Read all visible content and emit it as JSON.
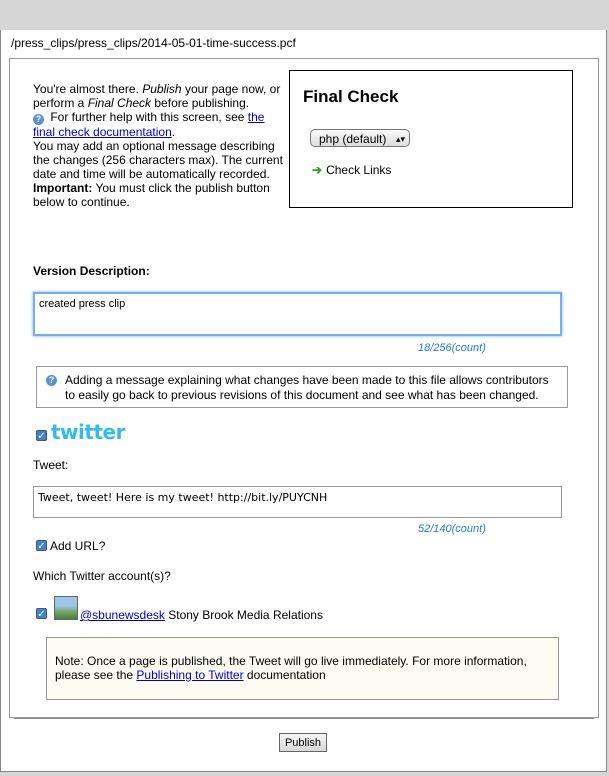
{
  "path": "/press_clips/press_clips/2014-05-01-time-success.pcf",
  "intro": {
    "line1_a": "You're almost there. ",
    "line1_em1": "Publish",
    "line1_b": " your page now, or perform a ",
    "line1_em2": "Final Check",
    "line1_c": " before publishing.",
    "help_a": " For further help with this screen, see ",
    "help_link": "the final check documentation",
    "help_b": ".",
    "message": "You may add an optional message describing the changes (256 characters max). The current date and time will be automatically recorded.",
    "important_label": "Important:",
    "important_text": " You must click the publish button below to continue."
  },
  "final_check": {
    "title": "Final Check",
    "select_value": "php (default)",
    "check_links": "Check Links"
  },
  "version": {
    "label": "Version Description:",
    "value": "created press clip",
    "count": "18/256(count)"
  },
  "info": "Adding a message explaining what changes have been made to this file allows contributors to easily go back to previous revisions of this document and see what has been changed.",
  "twitter": {
    "logo": "twitter",
    "tweet_label": "Tweet:",
    "tweet_value": "Tweet, tweet! Here is my tweet! http://bit.ly/PUYCNH",
    "count": "52/140(count)",
    "add_url": "Add URL?",
    "which_accounts": "Which Twitter account(s)?",
    "account_handle": "@sbunewsdesk",
    "account_name": " Stony Brook Media Relations"
  },
  "note": {
    "text_a": "Note: Once a page is published, the Tweet will go live immediately. For more information, please see the ",
    "link": "Publishing to Twitter",
    "text_b": " documentation"
  },
  "publish_label": "Publish",
  "colors": {
    "accent_blue": "#2a7ad0",
    "twitter_blue": "#33bbee",
    "link": "#0000cc"
  }
}
